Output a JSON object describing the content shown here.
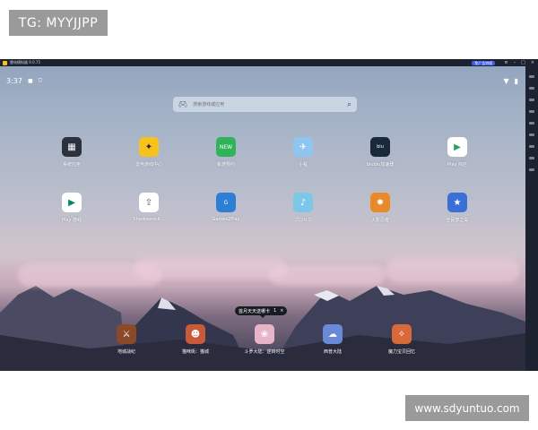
{
  "watermark_top": "TG: MYYJJPP",
  "watermark_bottom": "www.sdyuntuo.com",
  "titlebar": {
    "title": "雷电模拟器 9.0.75",
    "vip_label": "免广告特权"
  },
  "status": {
    "time": "3:37"
  },
  "search": {
    "placeholder": "搜索游戏或应用"
  },
  "apps_row1": [
    {
      "label": "系统应用",
      "color": "#2c3140"
    },
    {
      "label": "雷电游戏中心",
      "color": "#f6c21c"
    },
    {
      "label": "新游预约",
      "color": "#2fb35a"
    },
    {
      "label": "小程",
      "color": "#6fb7ee"
    },
    {
      "label": "biubiu加速器",
      "color": "#1a2a3a"
    },
    {
      "label": "Play 商店",
      "color": "#ffffff"
    }
  ],
  "apps_row2": [
    {
      "label": "Play 游戏",
      "color": "#ffffff"
    },
    {
      "label": "Shadowrock...",
      "color": "#ffffff"
    },
    {
      "label": "Games2Play",
      "color": "#2d7fd6"
    },
    {
      "label": "プロセカ",
      "color": "#7cc6e8"
    },
    {
      "label": "火影忍者",
      "color": "#e88a2a"
    },
    {
      "label": "全民梦之岛",
      "color": "#3a6fd8"
    }
  ],
  "dock": [
    {
      "label": "地城战纪",
      "color": "#8a4a2a"
    },
    {
      "label": "猫咪街：猫城",
      "color": "#c85a3a"
    },
    {
      "label": "斗罗大陆：逆转时空",
      "color": "#e8b4c8"
    },
    {
      "label": "西普大陆",
      "color": "#6a8ad8"
    },
    {
      "label": "魔力宝贝回忆",
      "color": "#d86a3a"
    }
  ],
  "banner": {
    "text": "首月天天送哪卡",
    "count": "1"
  }
}
